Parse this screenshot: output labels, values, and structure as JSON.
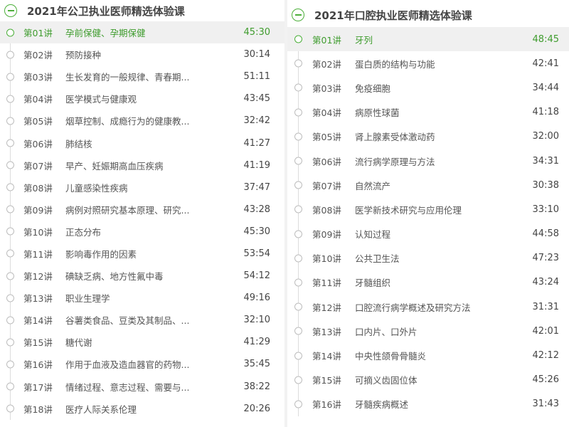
{
  "colors": {
    "accent": "#4caf3a",
    "active_text": "#3f9c2e",
    "active_bg": "#f0f0f0",
    "text": "#555555",
    "timeline": "#dcdcdc"
  },
  "courses": [
    {
      "title": "2021年公卫执业医师精选体验课",
      "collapse_icon": "minus-circle-icon",
      "lectures": [
        {
          "no": "第01讲",
          "title": "孕前保健、孕期保健",
          "duration": "45:30",
          "active": true
        },
        {
          "no": "第02讲",
          "title": "预防接种",
          "duration": "30:14"
        },
        {
          "no": "第03讲",
          "title": "生长发育的一般规律、青春期...",
          "duration": "51:11"
        },
        {
          "no": "第04讲",
          "title": "医学模式与健康观",
          "duration": "43:45"
        },
        {
          "no": "第05讲",
          "title": "烟草控制、成瘾行为的健康教...",
          "duration": "32:42"
        },
        {
          "no": "第06讲",
          "title": "肺结核",
          "duration": "41:27"
        },
        {
          "no": "第07讲",
          "title": "早产、妊娠期高血压疾病",
          "duration": "41:19"
        },
        {
          "no": "第08讲",
          "title": "儿童感染性疾病",
          "duration": "37:47"
        },
        {
          "no": "第09讲",
          "title": "病例对照研究基本原理、研究...",
          "duration": "43:28"
        },
        {
          "no": "第10讲",
          "title": "正态分布",
          "duration": "45:30"
        },
        {
          "no": "第11讲",
          "title": "影响毒作用的因素",
          "duration": "53:54"
        },
        {
          "no": "第12讲",
          "title": "碘缺乏病、地方性氟中毒",
          "duration": "54:12"
        },
        {
          "no": "第13讲",
          "title": "职业生理学",
          "duration": "49:16"
        },
        {
          "no": "第14讲",
          "title": "谷薯类食品、豆类及其制品、...",
          "duration": "32:10"
        },
        {
          "no": "第15讲",
          "title": "糖代谢",
          "duration": "41:29"
        },
        {
          "no": "第16讲",
          "title": "作用于血液及造血器官的药物...",
          "duration": "35:45"
        },
        {
          "no": "第17讲",
          "title": "情绪过程、意志过程、需要与...",
          "duration": "38:22"
        },
        {
          "no": "第18讲",
          "title": "医疗人际关系伦理",
          "duration": "20:26"
        }
      ]
    },
    {
      "title": "2021年口腔执业医师精选体验课",
      "collapse_icon": "minus-circle-icon",
      "lectures": [
        {
          "no": "第01讲",
          "title": "牙列",
          "duration": "48:45",
          "active": true
        },
        {
          "no": "第02讲",
          "title": "蛋白质的结构与功能",
          "duration": "42:41"
        },
        {
          "no": "第03讲",
          "title": "免疫细胞",
          "duration": "34:44"
        },
        {
          "no": "第04讲",
          "title": "病原性球菌",
          "duration": "41:18"
        },
        {
          "no": "第05讲",
          "title": "肾上腺素受体激动药",
          "duration": "32:00"
        },
        {
          "no": "第06讲",
          "title": "流行病学原理与方法",
          "duration": "34:31"
        },
        {
          "no": "第07讲",
          "title": "自然流产",
          "duration": "30:38"
        },
        {
          "no": "第08讲",
          "title": "医学新技术研究与应用伦理",
          "duration": "33:10"
        },
        {
          "no": "第09讲",
          "title": "认知过程",
          "duration": "44:58"
        },
        {
          "no": "第10讲",
          "title": "公共卫生法",
          "duration": "47:23"
        },
        {
          "no": "第11讲",
          "title": "牙髓组织",
          "duration": "43:24"
        },
        {
          "no": "第12讲",
          "title": "口腔流行病学概述及研究方法",
          "duration": "31:31"
        },
        {
          "no": "第13讲",
          "title": "口内片、口外片",
          "duration": "42:01"
        },
        {
          "no": "第14讲",
          "title": "中央性颌骨骨髓炎",
          "duration": "42:12"
        },
        {
          "no": "第15讲",
          "title": "可摘义齿固位体",
          "duration": "45:26"
        },
        {
          "no": "第16讲",
          "title": "牙髓疾病概述",
          "duration": "31:43"
        }
      ]
    }
  ]
}
